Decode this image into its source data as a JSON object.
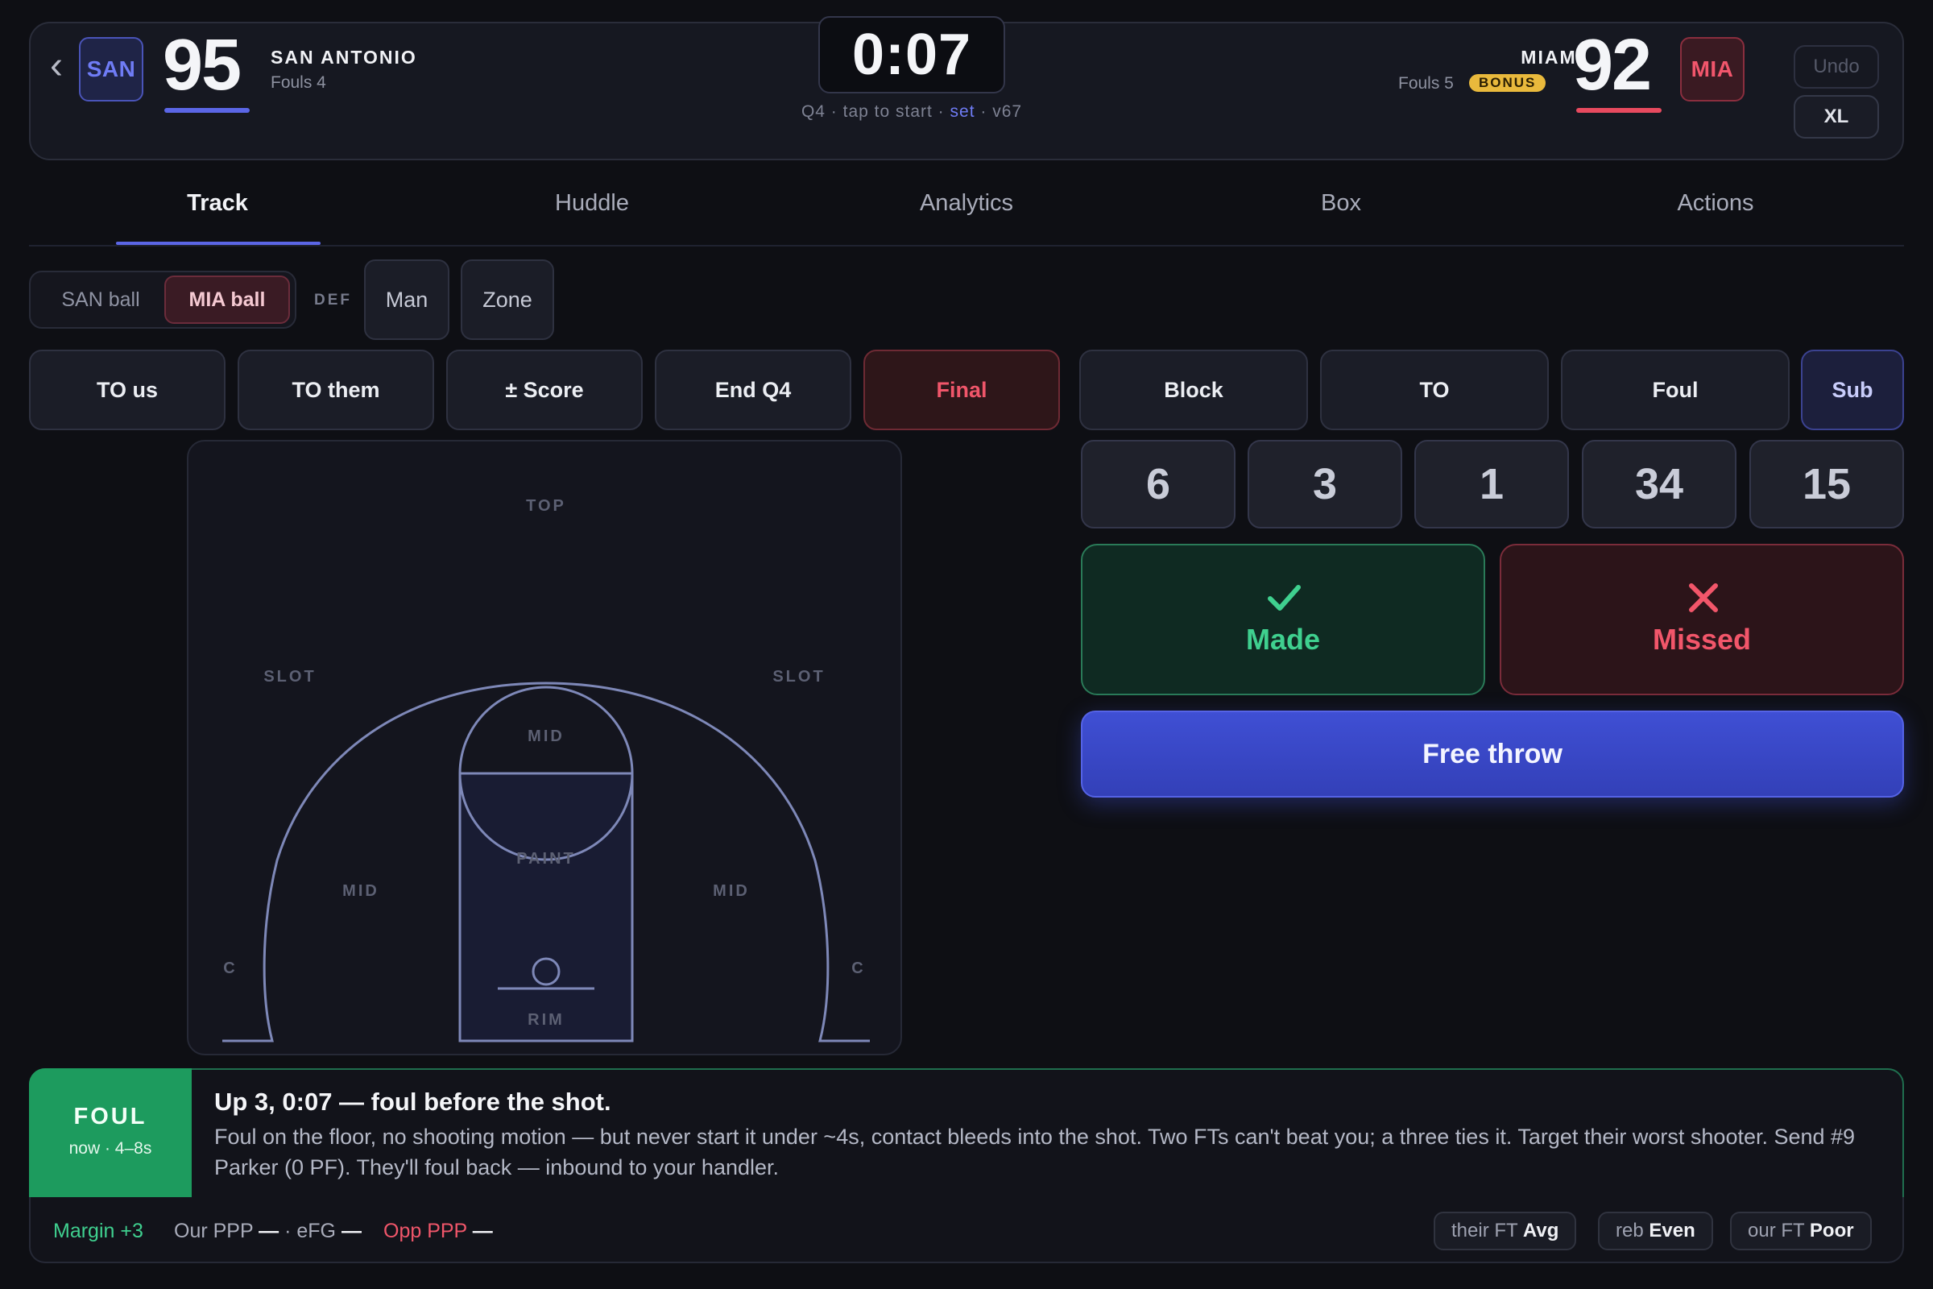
{
  "header": {
    "back_icon": "chevron-left-icon",
    "home": {
      "abbr": "SAN",
      "score": "95",
      "name": "SAN ANTONIO",
      "fouls": "Fouls 4",
      "color": "#5b66e6"
    },
    "away": {
      "abbr": "MIA",
      "score": "92",
      "name": "MIAMI",
      "fouls": "Fouls 5",
      "bonus": "BONUS",
      "color": "#e84a5f"
    },
    "clock": "0:07",
    "period": "Q4",
    "clock_hint": "tap to start",
    "clock_set": "set",
    "version": "v67",
    "undo_label": "Undo",
    "size_label": "XL"
  },
  "tabs": [
    {
      "label": "Track",
      "active": true
    },
    {
      "label": "Huddle",
      "active": false
    },
    {
      "label": "Analytics",
      "active": false
    },
    {
      "label": "Box",
      "active": false
    },
    {
      "label": "Actions",
      "active": false
    }
  ],
  "possession": {
    "san_label": "SAN ball",
    "mia_label": "MIA ball",
    "selected": "MIA ball"
  },
  "defense": {
    "label": "DEF",
    "man_label": "Man",
    "zone_label": "Zone"
  },
  "game_actions": [
    "TO us",
    "TO them",
    "± Score",
    "End Q4",
    "Final"
  ],
  "stat_actions": [
    "Block",
    "TO",
    "Foul",
    "Sub"
  ],
  "players": [
    "6",
    "3",
    "1",
    "34",
    "15"
  ],
  "shot": {
    "made_label": "Made",
    "missed_label": "Missed",
    "free_throw_label": "Free throw"
  },
  "court": {
    "zones": {
      "top": "TOP",
      "slot": "SLOT",
      "mid": "MID",
      "paint": "PAINT",
      "corner": "C",
      "rim": "RIM"
    }
  },
  "advice": {
    "tag": "FOUL",
    "tag_sub": "now · 4–8s",
    "title": "Up 3, 0:07 — foul before the shot.",
    "body": "Foul on the floor, no shooting motion — but never start it under ~4s, contact bleeds into the shot. Two FTs can't beat you; a three ties it. Target their worst shooter. Send #9 Parker (0 PF). They'll foul back — inbound to your handler."
  },
  "footer": {
    "margin": "Margin +3",
    "our_ppp_label": "Our PPP",
    "our_ppp_value": "—",
    "efg_label": "eFG",
    "efg_value": "—",
    "opp_ppp_label": "Opp PPP",
    "opp_ppp_value": "—",
    "chips": [
      {
        "label": "their FT",
        "value": "Avg"
      },
      {
        "label": "reb",
        "value": "Even"
      },
      {
        "label": "our FT",
        "value": "Poor"
      }
    ]
  }
}
